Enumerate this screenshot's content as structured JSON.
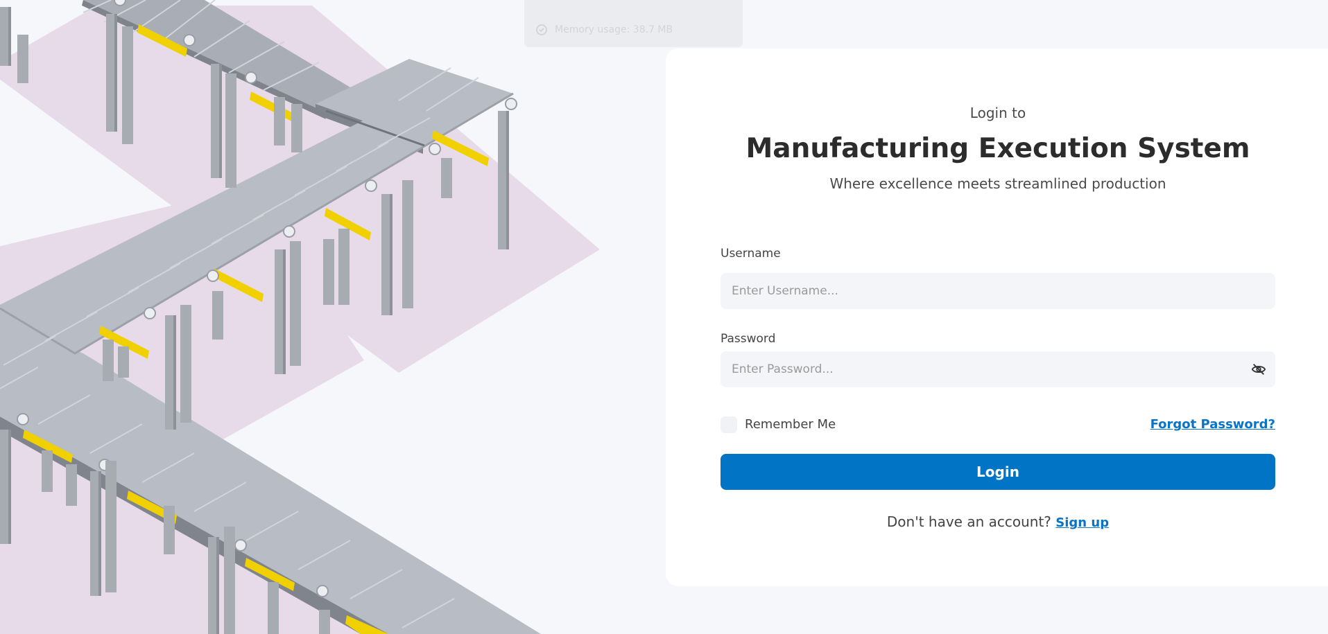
{
  "memory": {
    "text": "Memory usage: 38.7 MB"
  },
  "login": {
    "kicker": "Login to",
    "title": "Manufacturing Execution System",
    "subtitle": "Where excellence meets streamlined production",
    "username_label": "Username",
    "username_placeholder": "Enter Username...",
    "password_label": "Password",
    "password_placeholder": "Enter Password...",
    "remember_label": "Remember Me",
    "forgot_label": "Forgot Password?",
    "login_button": "Login",
    "signup_prompt": "Don't have an account?",
    "signup_link": "Sign up"
  },
  "theme": {
    "accent": "#0174c6",
    "background": "#f6f7fb",
    "card": "#ffffff",
    "conveyor_shadow": "#e8dbe9"
  },
  "icons": {
    "memory": "memory-icon",
    "password_toggle": "eye-off-icon"
  }
}
